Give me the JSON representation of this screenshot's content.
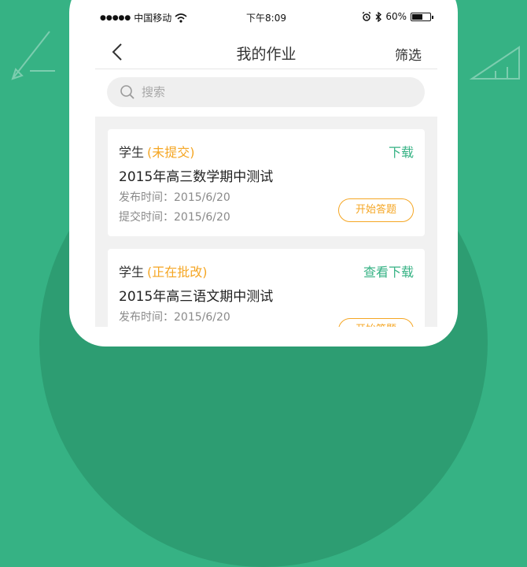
{
  "status_bar": {
    "signal_dots": "●●●●●",
    "carrier": "中国移动",
    "time": "下午8:09",
    "battery": "60%",
    "battery_level": 0.6
  },
  "nav": {
    "title": "我的作业",
    "filter_label": "筛选"
  },
  "search": {
    "placeholder": "搜索"
  },
  "cards": [
    {
      "student": "学生",
      "status": "(未提交)",
      "action": "下载",
      "title": "2015年高三数学期中测试",
      "publish": "发布时间：2015/6/20",
      "submit": "提交时间：2015/6/20",
      "button": "开始答题"
    },
    {
      "student": "学生",
      "status": "(正在批改)",
      "action": "查看下载",
      "title": "2015年高三语文期中测试",
      "publish": "发布时间：2015/6/20",
      "button": "开始答题"
    }
  ],
  "colors": {
    "accent_green": "#36b284",
    "status_orange": "#f5a623"
  }
}
